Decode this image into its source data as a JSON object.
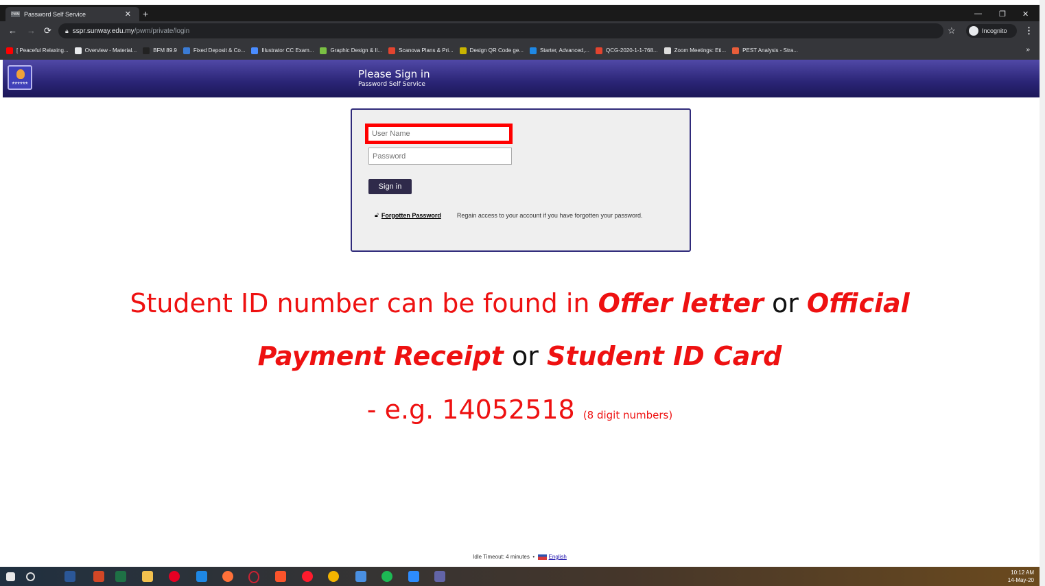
{
  "browser": {
    "tab_title": "Password Self Service",
    "tab_favicon": "PWM",
    "url_host": "sspr.sunway.edu.my",
    "url_path": "/pwm/private/login",
    "incognito_label": "Incognito",
    "bookmarks": [
      {
        "label": "[ Peaceful Relaxing...",
        "color": "#ff0000"
      },
      {
        "label": "Overview - Material...",
        "color": "#e8eaed"
      },
      {
        "label": "BFM 89.9",
        "color": "#222222"
      },
      {
        "label": "Fixed Deposit & Co...",
        "color": "#3a7bd5"
      },
      {
        "label": "Illustrator CC Exam...",
        "color": "#4a8cff"
      },
      {
        "label": "Graphic Design & Il...",
        "color": "#7ac043"
      },
      {
        "label": "Scanova Plans & Pri...",
        "color": "#e2442f"
      },
      {
        "label": "Design QR Code ge...",
        "color": "#c8b400"
      },
      {
        "label": "Starter, Advanced,...",
        "color": "#1e88e5"
      },
      {
        "label": "QCG-2020-1-1-768...",
        "color": "#e2442f"
      },
      {
        "label": "Zoom Meetings: Eti...",
        "color": "#dddddd"
      },
      {
        "label": "PEST Analysis - Stra...",
        "color": "#e85d3a"
      }
    ]
  },
  "header": {
    "title": "Please Sign in",
    "subtitle": "Password Self Service",
    "logo_text": "******"
  },
  "login": {
    "username_placeholder": "User Name",
    "password_placeholder": "Password",
    "signin_label": "Sign in",
    "forgot_link": "Forgotten Password",
    "forgot_desc": "Regain access to your account if you have forgotten your password."
  },
  "note": {
    "part1": "Student ID number can be found in ",
    "offer": "Offer letter",
    "or1": " or ",
    "official": "Official",
    "payment": "Payment Receipt",
    "or2": " or ",
    "card": "Student ID Card",
    "example": "- e.g. 14052518 ",
    "example_small": "(8 digit numbers)"
  },
  "footer": {
    "idle": "Idle Timeout: 4 minutes",
    "sep": "•",
    "language": "English"
  },
  "taskbar": {
    "time": "10:12 AM",
    "date": "14-May-20"
  }
}
